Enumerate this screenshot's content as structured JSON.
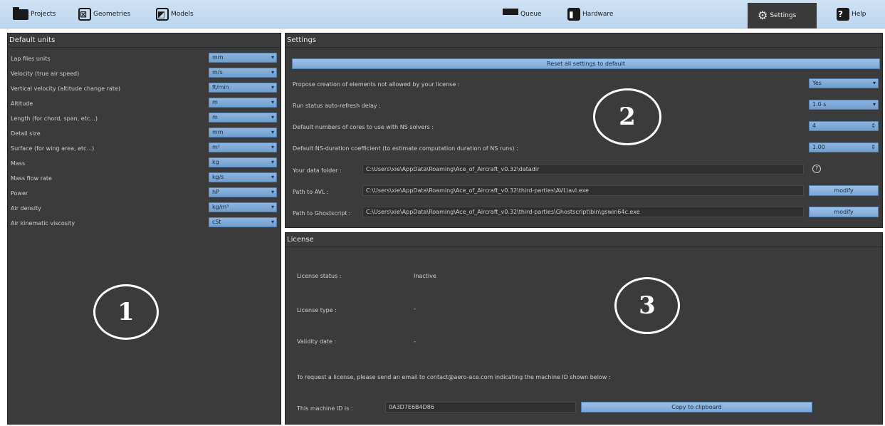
{
  "toolbar": {
    "projects": "Projects",
    "geometries": "Geometries",
    "models": "Models",
    "queue": "Queue",
    "hardware": "Hardware",
    "settings": "Settings",
    "help": "Help"
  },
  "default_units": {
    "title": "Default units",
    "rows": [
      {
        "label": "Lap files units",
        "value": "mm"
      },
      {
        "label": "Velocity (true air speed)",
        "value": "m/s"
      },
      {
        "label": "Vertical velocity (altitude change rate)",
        "value": "ft/min"
      },
      {
        "label": "Altitude",
        "value": "m"
      },
      {
        "label": "Length (for chord, span, etc...)",
        "value": "m"
      },
      {
        "label": "Detail size",
        "value": "mm"
      },
      {
        "label": "Surface (for wing area, etc...)",
        "value": "m²"
      },
      {
        "label": "Mass",
        "value": "kg"
      },
      {
        "label": "Mass flow rate",
        "value": "kg/s"
      },
      {
        "label": "Power",
        "value": "hP"
      },
      {
        "label": "Air density",
        "value": "kg/m³"
      },
      {
        "label": "Air kinematic viscosity",
        "value": "cSt"
      }
    ]
  },
  "settings": {
    "title": "Settings",
    "reset_button": "Reset all settings to default",
    "propose_label": "Propose creation of elements not allowed by your license :",
    "propose_value": "Yes",
    "refresh_label": "Run status auto-refresh delay :",
    "refresh_value": "1.0 s",
    "cores_label": "Default numbers of cores to use with NS solvers :",
    "cores_value": "4",
    "duration_label": "Default NS-duration coefficient (to estimate computation duration of NS runs) :",
    "duration_value": "1.00",
    "data_folder_label": "Your data folder :",
    "data_folder_value": "C:\\Users\\xie\\AppData\\Roaming\\Ace_of_Aircraft_v0.32\\datadir",
    "data_folder_help": "?",
    "avl_label": "Path to AVL :",
    "avl_value": "C:\\Users\\xie\\AppData\\Roaming\\Ace_of_Aircraft_v0.32\\third-parties\\AVL\\avl.exe",
    "avl_button": "modify",
    "gs_label": "Path to Ghostscript :",
    "gs_value": "C:\\Users\\xie\\AppData\\Roaming\\Ace_of_Aircraft_v0.32\\third-parties\\Ghostscript\\bin\\gswin64c.exe",
    "gs_button": "modify"
  },
  "license": {
    "title": "License",
    "status_label": "License status :",
    "status_value": "Inactive",
    "type_label": "License type :",
    "type_value": "-",
    "validity_label": "Validity date :",
    "validity_value": "-",
    "request_text": "To request a license, please send an email to contact@aero-ace.com indicating the machine ID shown below :",
    "machine_label": "This machine ID is :",
    "machine_value": "0A3D7E6B4D86",
    "copy_button": "Copy to clipboard"
  },
  "callouts": {
    "one": "1",
    "two": "2",
    "three": "3"
  }
}
